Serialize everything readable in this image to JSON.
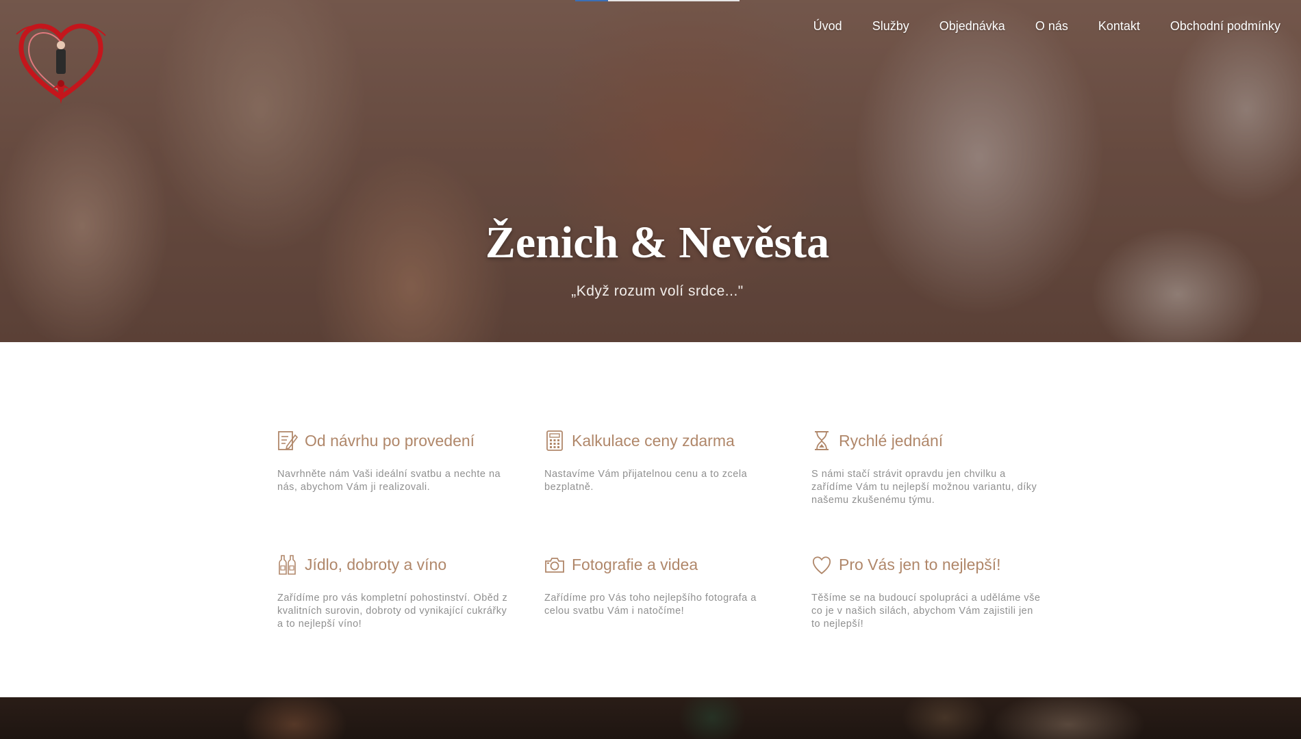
{
  "brand": {
    "logo_name": "zenich-nevesta-heart-logo",
    "logo_text": "Ženich & Nevěsta"
  },
  "nav": {
    "items": [
      {
        "label": "Úvod"
      },
      {
        "label": "Služby"
      },
      {
        "label": "Objednávka"
      },
      {
        "label": "O nás"
      },
      {
        "label": "Kontakt"
      },
      {
        "label": "Obchodní podmínky"
      }
    ]
  },
  "hero": {
    "title": "Ženich & Nevěsta",
    "subtitle": "„Když rozum volí srdce...\""
  },
  "features": [
    {
      "icon": "edit-document-icon",
      "title": "Od návrhu po provedení",
      "text": "Navrhněte nám Vaši ideální svatbu a nechte na nás, abychom Vám ji realizovali."
    },
    {
      "icon": "calculator-icon",
      "title": "Kalkulace ceny zdarma",
      "text": "Nastavíme Vám přijatelnou cenu a to zcela bezplatně."
    },
    {
      "icon": "hourglass-icon",
      "title": "Rychlé jednání",
      "text": "S námi stačí strávit opravdu jen chvilku a zařídíme Vám tu nejlepší možnou variantu, díky našemu zkušenému týmu."
    },
    {
      "icon": "wine-bottles-icon",
      "title": "Jídlo, dobroty a víno",
      "text": "Zařídíme pro vás kompletní pohostinství. Oběd z kvalitních surovin, dobroty od vynikající cukrářky a to nejlepší víno!"
    },
    {
      "icon": "camera-icon",
      "title": "Fotografie a videa",
      "text": "Zařídíme pro Vás toho nejlepšího fotografa a celou svatbu Vám i natočíme!"
    },
    {
      "icon": "heart-icon",
      "title": "Pro Vás jen to nejlepší!",
      "text": "Těšíme se na budoucí spolupráci a uděláme vše co je v našich silách, abychom Vám zajistili jen to nejlepší!"
    }
  ],
  "colors": {
    "accent": "#b0876a",
    "body_text": "#8f8f8f",
    "nav_text": "#ffffff"
  }
}
